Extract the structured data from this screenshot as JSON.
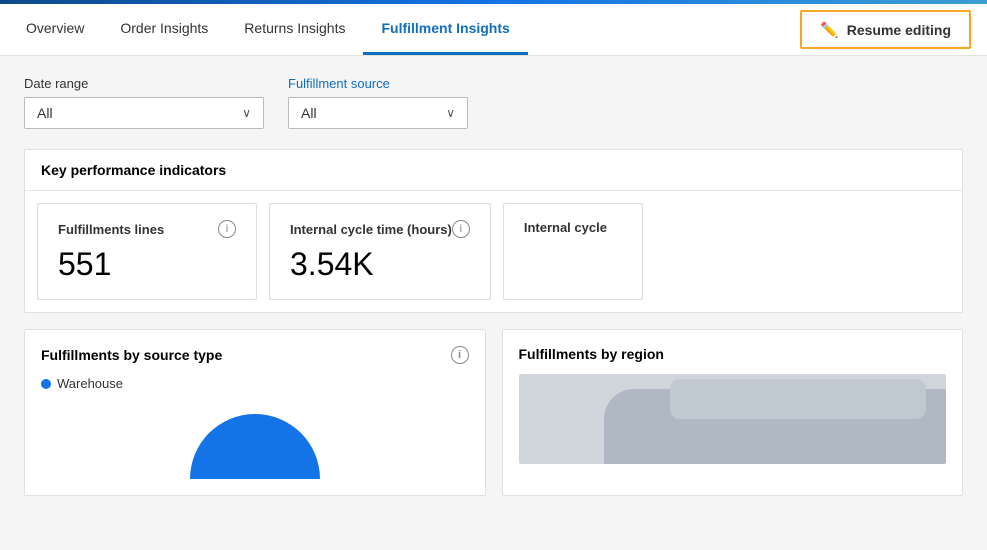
{
  "accent": {},
  "nav": {
    "tabs": [
      {
        "id": "overview",
        "label": "Overview",
        "active": false
      },
      {
        "id": "order-insights",
        "label": "Order Insights",
        "active": false
      },
      {
        "id": "returns-insights",
        "label": "Returns Insights",
        "active": false
      },
      {
        "id": "fulfillment-insights",
        "label": "Fulfillment Insights",
        "active": true
      }
    ],
    "resume_editing_label": "Resume editing"
  },
  "filters": {
    "date_range": {
      "label": "Date range",
      "value": "All"
    },
    "fulfillment_source": {
      "label": "Fulfillment source",
      "value": "All"
    }
  },
  "kpi_section": {
    "title": "Key performance indicators",
    "cards": [
      {
        "title": "Fulfillments lines",
        "value": "551"
      },
      {
        "title": "Internal cycle time (hours)",
        "value": "3.54K"
      },
      {
        "title": "Internal cycle",
        "value": ""
      }
    ]
  },
  "bottom_section": {
    "left_card": {
      "title": "Fulfillments by source type",
      "legend": [
        {
          "label": "Warehouse",
          "color": "#1473e6"
        }
      ]
    },
    "right_card": {
      "title": "Fulfillments by region"
    }
  },
  "icons": {
    "pencil": "✏️",
    "info": "i",
    "chevron_down": "∨"
  }
}
